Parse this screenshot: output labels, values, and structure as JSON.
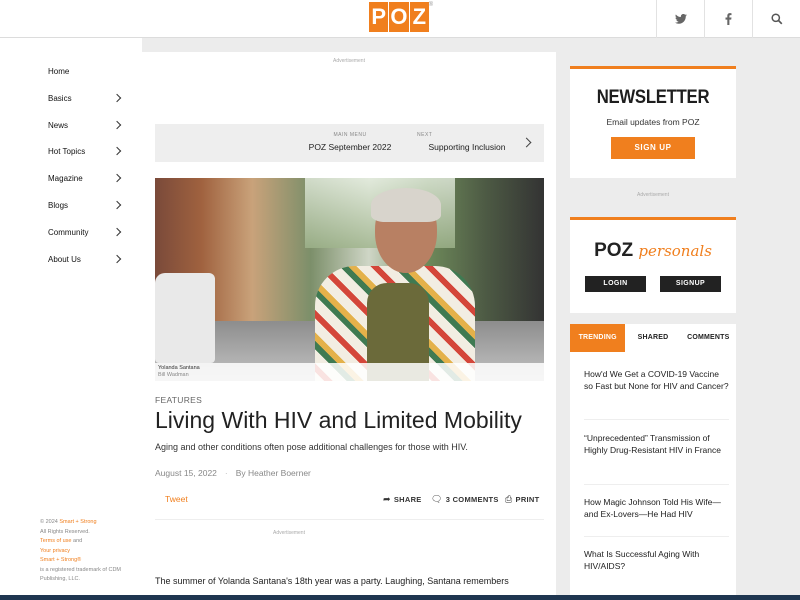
{
  "header": {
    "logo_letters": [
      "P",
      "O",
      "Z"
    ],
    "logo_mark": "®",
    "social": [
      {
        "icon": "twitter-icon",
        "glyph": "🐦"
      },
      {
        "icon": "facebook-icon",
        "glyph": "f"
      },
      {
        "icon": "search-icon",
        "glyph": "⌕"
      }
    ]
  },
  "sidebar": {
    "items": [
      {
        "label": "Home",
        "has_submenu": false
      },
      {
        "label": "Basics",
        "has_submenu": true
      },
      {
        "label": "News",
        "has_submenu": true
      },
      {
        "label": "Hot Topics",
        "has_submenu": true
      },
      {
        "label": "Magazine",
        "has_submenu": true
      },
      {
        "label": "Blogs",
        "has_submenu": true
      },
      {
        "label": "Community",
        "has_submenu": true
      },
      {
        "label": "About Us",
        "has_submenu": true
      }
    ],
    "legal": {
      "copyright": "© 2024",
      "company": "Smart + Strong",
      "rights": "All Rights Reserved.",
      "terms": "Terms of use",
      "and": "and",
      "privacy": "Your privacy",
      "trademark_name": "Smart + Strong®",
      "trademark_text": "is a registered trademark of CDM Publishing, LLC."
    }
  },
  "article": {
    "ad_label_top": "Advertisement",
    "main_menu_label": "MAIN MENU",
    "main_menu_value": "POZ September 2022",
    "next_label": "NEXT",
    "next_value": "Supporting Inclusion",
    "photo_caption": "Yolanda Santana",
    "photo_credit": "Bill Wadman",
    "category": "FEATURES",
    "headline": "Living With HIV and Limited Mobility",
    "dek": "Aging and other conditions often pose additional challenges for those with HIV.",
    "date": "August 15, 2022",
    "byline": "By Heather Boerner",
    "tweet": "Tweet",
    "share": "SHARE",
    "comments": "3 COMMENTS",
    "print": "PRINT",
    "ad_label_mid": "Advertisement",
    "body_start": "The summer of Yolanda Santana's 18th year was a party. Laughing, Santana remembers"
  },
  "newsletter": {
    "title": "NEWSLETTER",
    "subtitle": "Email updates from POZ",
    "button": "SIGN UP",
    "ad_label": "Advertisement"
  },
  "personals": {
    "brand": "POZ",
    "script": "personals",
    "login": "LOGIN",
    "signup": "SIGNUP"
  },
  "tabs": [
    "TRENDING",
    "SHARED",
    "COMMENTS"
  ],
  "trending": [
    "How'd We Get a COVID-19 Vaccine so Fast but None for HIV and Cancer?",
    "“Unprecedented” Transmission of Highly Drug-Resistant HIV in France",
    "How Magic Johnson Told His Wife—and Ex-Lovers—He Had HIV",
    "What Is Successful Aging With HIV/AIDS?"
  ],
  "colors": {
    "accent": "#f07f1e",
    "dark": "#222222",
    "footer_bar": "#1f3650"
  }
}
